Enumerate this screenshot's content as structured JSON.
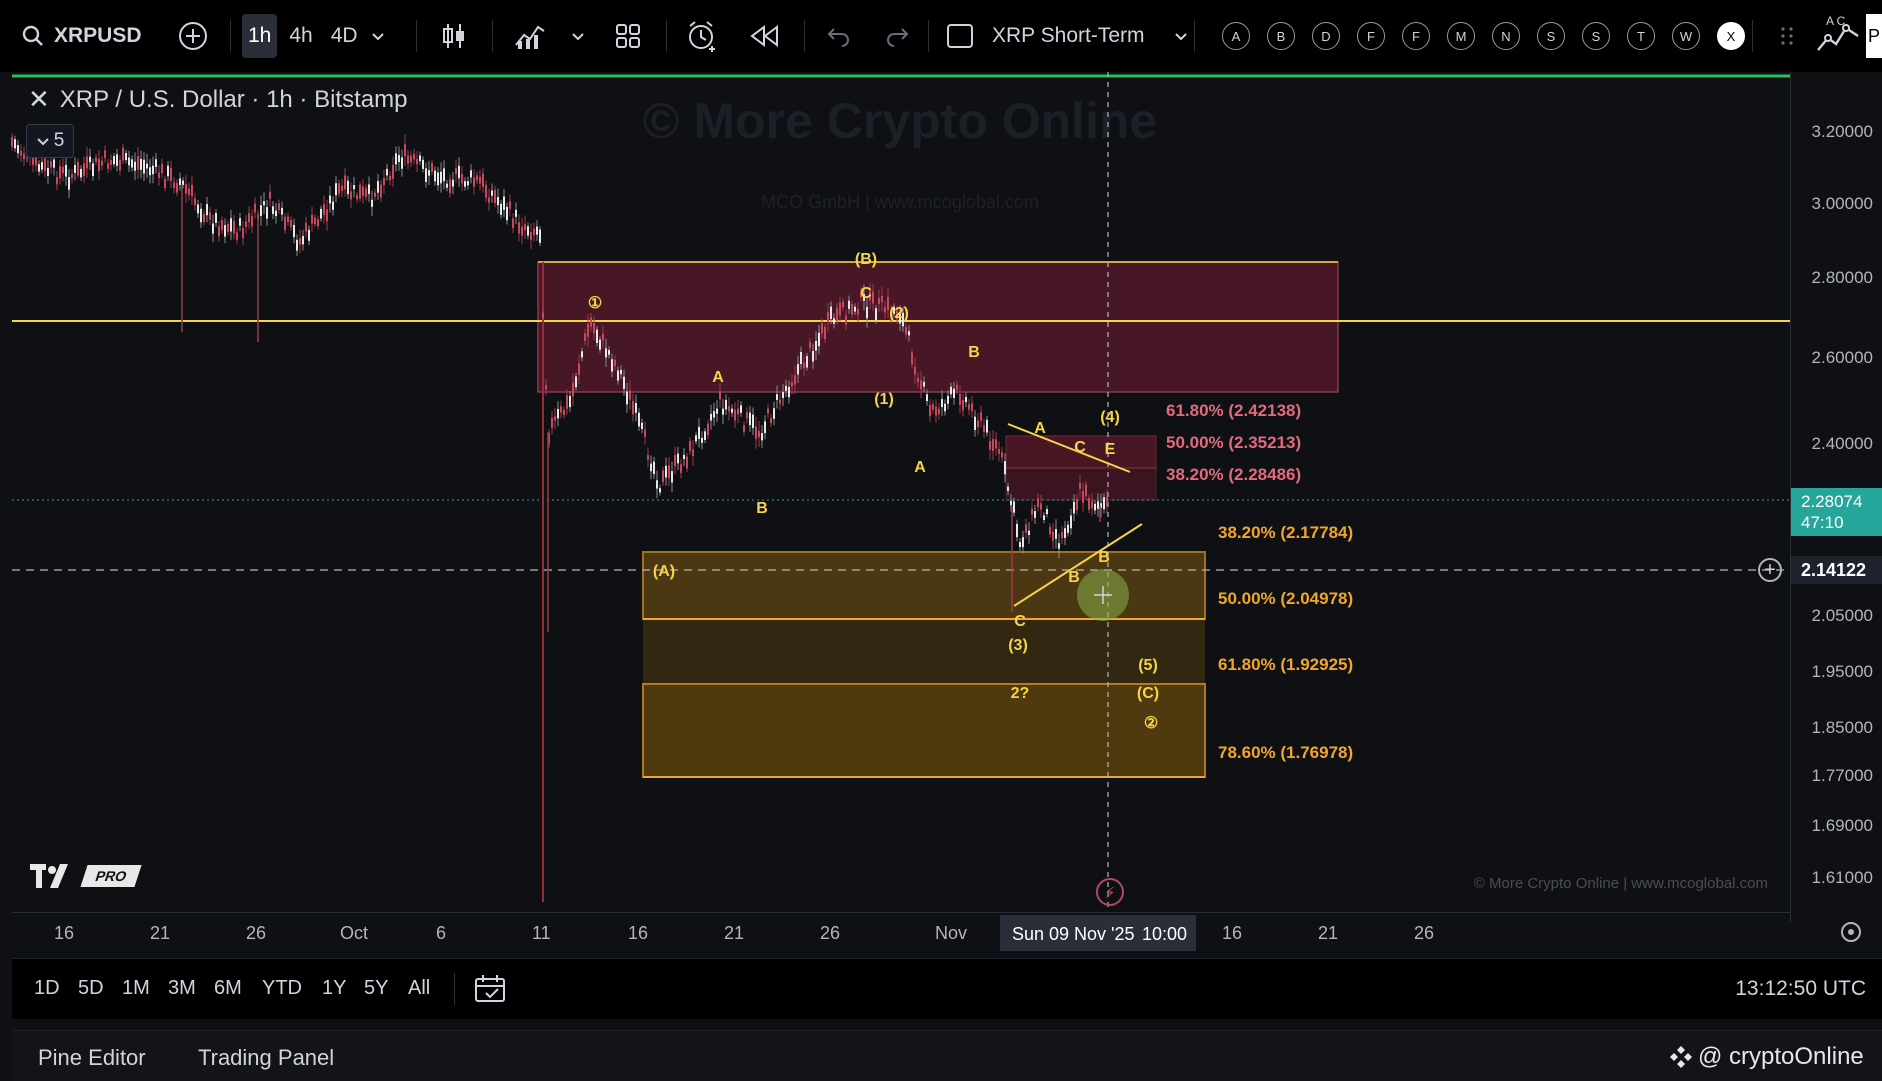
{
  "toolbar": {
    "symbol": "XRPUSD",
    "timeframes": [
      "1h",
      "4h",
      "4D"
    ],
    "active_timeframe": "1h",
    "layout_name": "XRP Short-Term",
    "letters": [
      "A",
      "B",
      "D",
      "F",
      "F",
      "M",
      "N",
      "S",
      "S",
      "T",
      "W",
      "X"
    ],
    "active_letter": "X",
    "right_partial": "A C",
    "right_edge": "P"
  },
  "legend": {
    "title": "XRP / U.S. Dollar · 1h · Bitstamp",
    "collapse_count": "5"
  },
  "watermark": {
    "main": "© More Crypto Online",
    "sub": "MCO GmbH  |  www.mcoglobal.com",
    "bottom": "© More Crypto Online  |  www.mcoglobal.com"
  },
  "price_axis": {
    "labels": [
      "3.20000",
      "3.00000",
      "2.80000",
      "2.60000",
      "2.40000",
      "2.05000",
      "1.95000",
      "1.85000",
      "1.77000",
      "1.69000",
      "1.61000"
    ],
    "current_price": "2.28074",
    "countdown": "47:10",
    "crosshair_price": "2.14122"
  },
  "time_axis": {
    "labels": [
      "16",
      "21",
      "26",
      "Oct",
      "6",
      "11",
      "16",
      "21",
      "26",
      "Nov",
      "16",
      "21",
      "26"
    ],
    "crosshair_date": "Sun 09 Nov '25",
    "crosshair_time": "10:00"
  },
  "fib_upper": [
    {
      "label": "61.80% (2.42138)"
    },
    {
      "label": "50.00% (2.35213)"
    },
    {
      "label": "38.20% (2.28486)"
    }
  ],
  "fib_lower": [
    {
      "label": "38.20% (2.17784)"
    },
    {
      "label": "50.00% (2.04978)"
    },
    {
      "label": "61.80% (1.92925)"
    },
    {
      "label": "78.60% (1.76978)"
    }
  ],
  "waves": [
    "①",
    "(B)",
    "C",
    "(2)",
    "B",
    "A",
    "(1)",
    "A",
    "B",
    "A",
    "C",
    "E",
    "(4)",
    "B",
    "B",
    "C",
    "(3)",
    "(A)",
    "2?",
    "(5)",
    "(C)",
    "②"
  ],
  "range_buttons": [
    "1D",
    "5D",
    "1M",
    "3M",
    "6M",
    "YTD",
    "1Y",
    "5Y",
    "All"
  ],
  "clock": "13:12:50 UTC",
  "footer": {
    "pine_editor": "Pine Editor",
    "trading_panel": "Trading Panel",
    "brand": "@ cryptoOnline"
  },
  "logo": {
    "badge": "PRO"
  },
  "colors": {
    "accent_yellow": "#f5d547",
    "fib_orange": "#f0a62b",
    "red_zone": "#7a1e33",
    "green_price": "#26a69a",
    "top_line": "#2ebd59"
  }
}
